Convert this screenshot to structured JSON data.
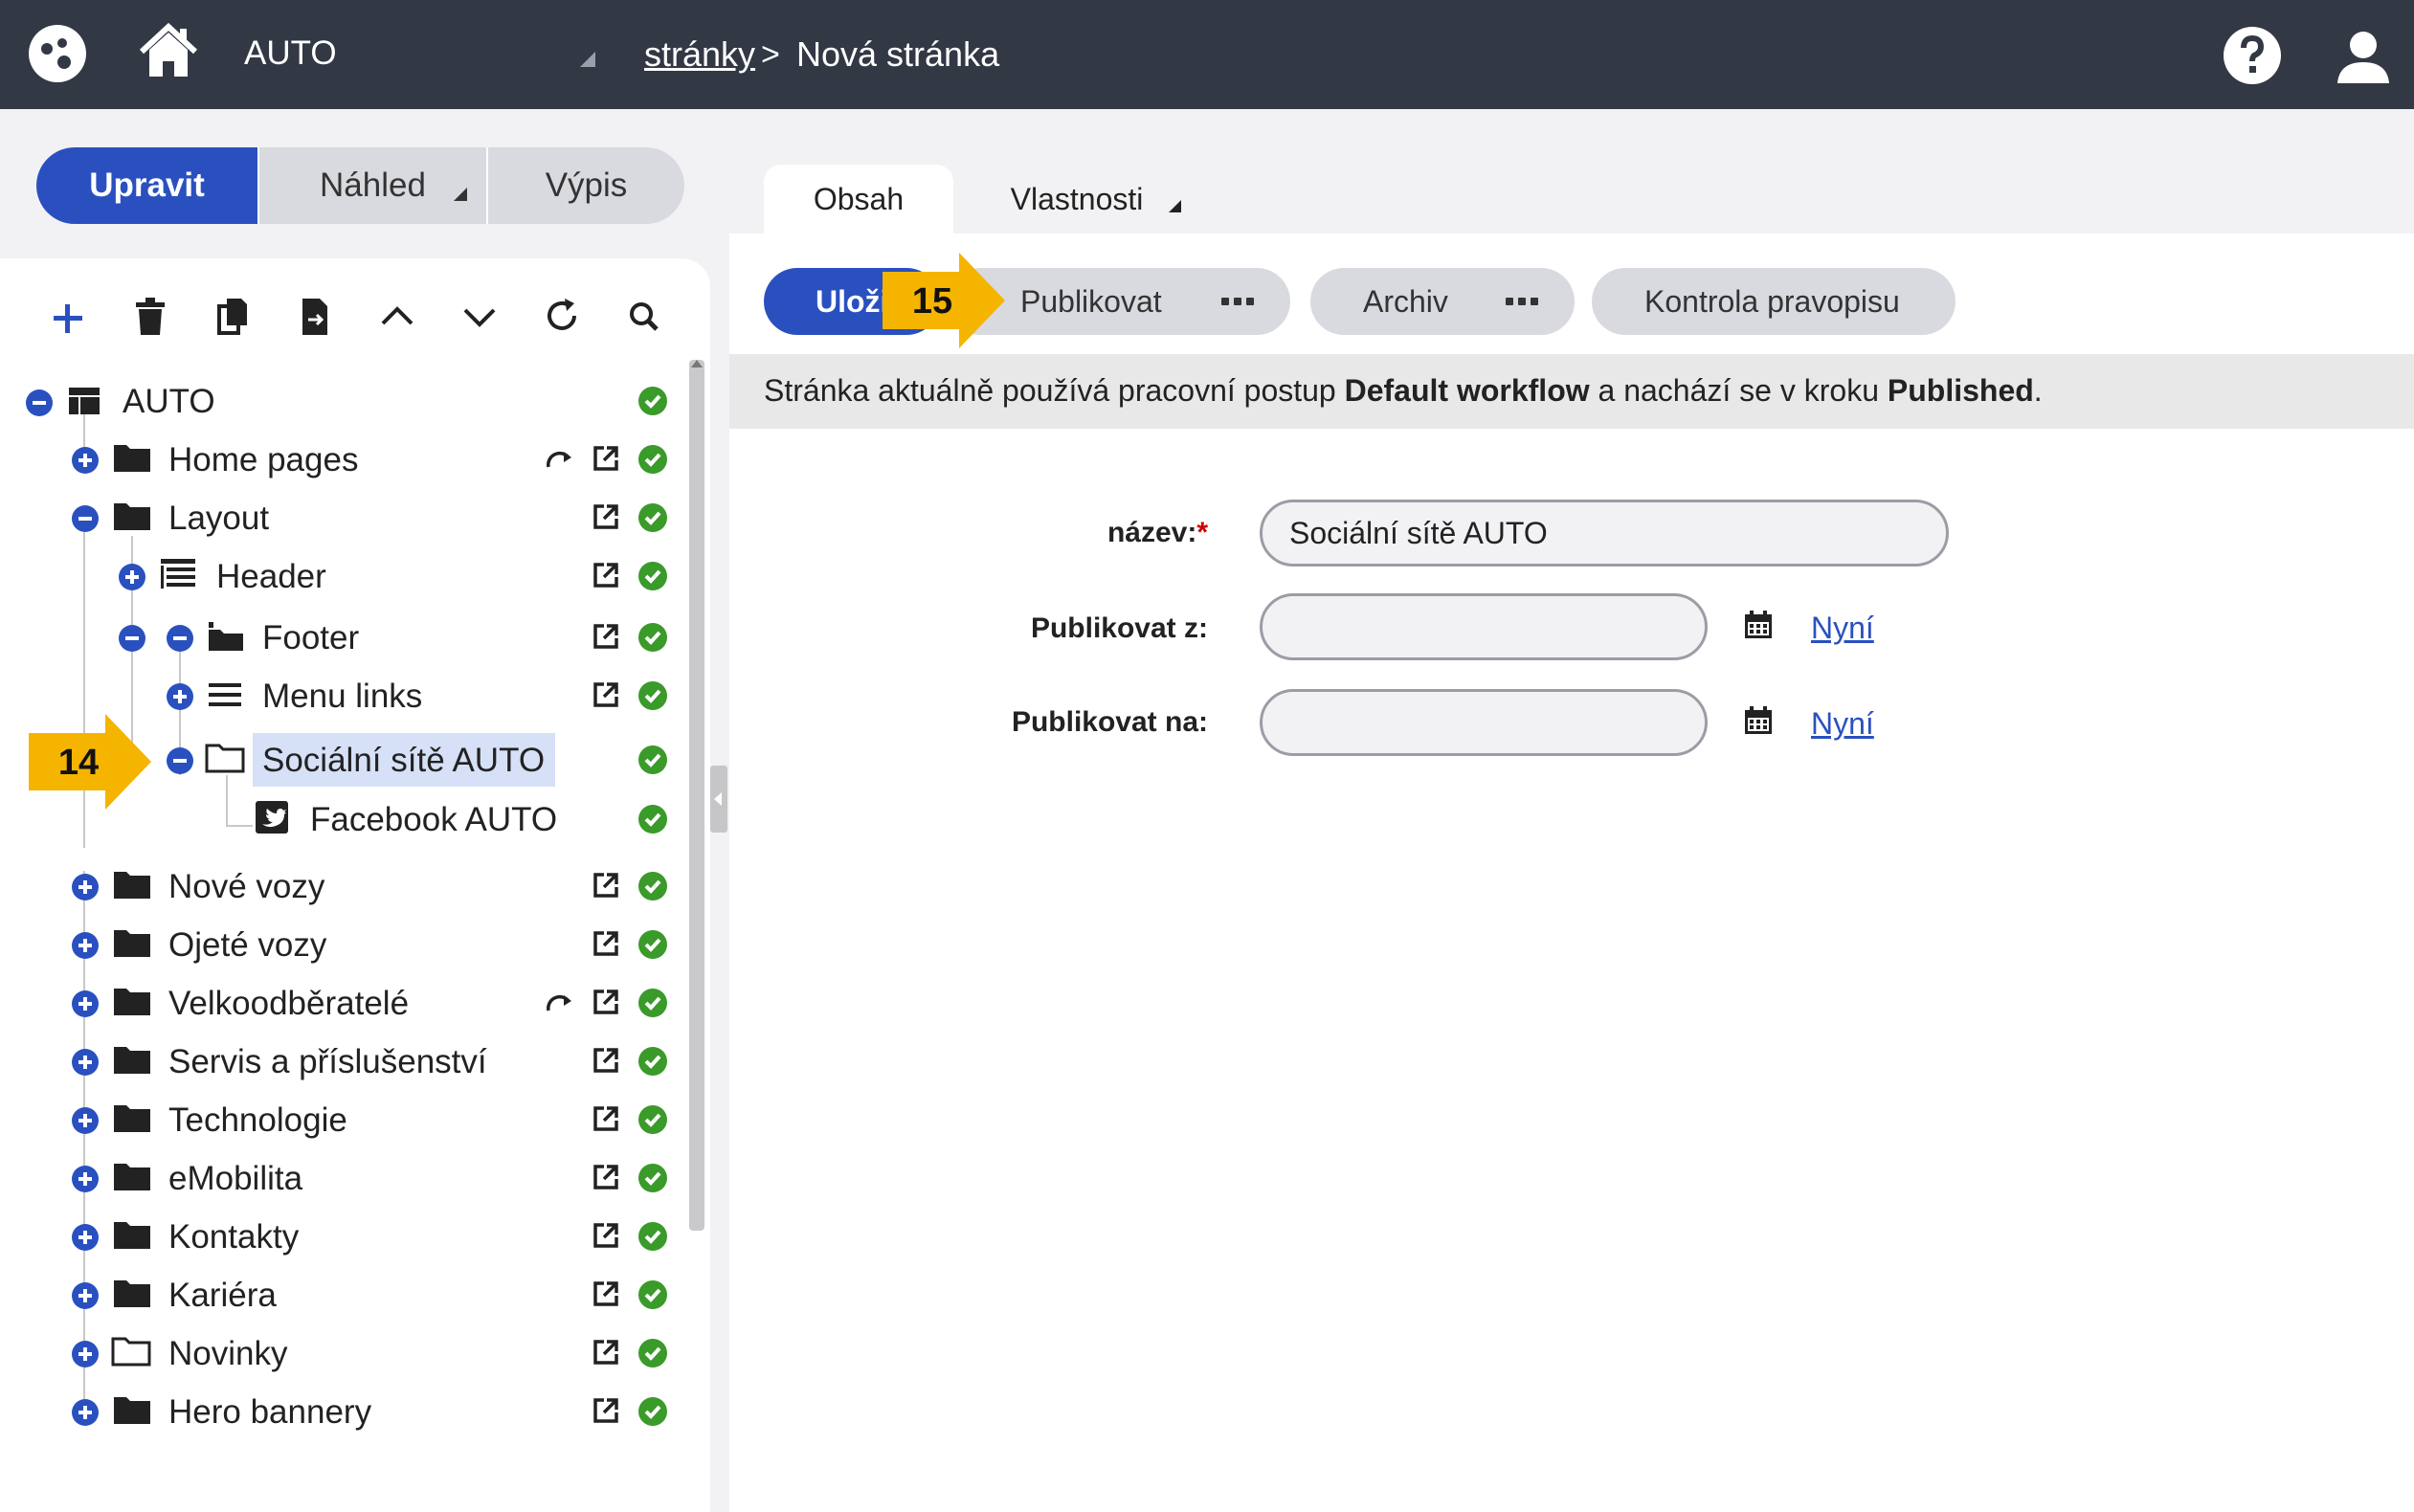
{
  "topbar": {
    "site": "AUTO",
    "breadcrumb_link": "stránky",
    "breadcrumb_sep": ">",
    "breadcrumb_current": "Nová stránka"
  },
  "modes": {
    "edit": "Upravit",
    "preview": "Náhled",
    "list": "Výpis"
  },
  "tree": {
    "root": "AUTO",
    "items": {
      "home_pages": "Home pages",
      "layout": "Layout",
      "header": "Header",
      "footer": "Footer",
      "menu_links": "Menu links",
      "socialni_site": "Sociální sítě AUTO",
      "facebook": "Facebook AUTO",
      "nove_vozy": "Nové vozy",
      "ojete_vozy": "Ojeté vozy",
      "velkoodberatele": "Velkoodběratelé",
      "servis": "Servis a příslušenství",
      "technologie": "Technologie",
      "emobilita": "eMobilita",
      "kontakty": "Kontakty",
      "kariera": "Kariéra",
      "novinky": "Novinky",
      "hero": "Hero bannery"
    }
  },
  "callouts": {
    "c14": "14",
    "c15": "15"
  },
  "tabs": {
    "content": "Obsah",
    "properties": "Vlastnosti"
  },
  "actions": {
    "save": "Uloži",
    "publish": "Publikovat",
    "archive": "Archiv",
    "spellcheck": "Kontrola pravopisu"
  },
  "info": {
    "part1": "Stránka aktuálně používá pracovní postup ",
    "workflow": "Default workflow",
    "part2": " a nachází se v kroku ",
    "step": "Published",
    "part3": "."
  },
  "form": {
    "name_label": "název:",
    "required_mark": "*",
    "name_value": "Sociální sítě AUTO",
    "publish_from_label": "Publikovat z:",
    "publish_from_value": "",
    "publish_to_label": "Publikovat na:",
    "publish_to_value": "",
    "now_link": "Nyní"
  },
  "colors": {
    "topbar": "#323844",
    "accent": "#2a50c0",
    "ok_green": "#3a9a2a",
    "callout_yellow": "#f5b400"
  }
}
